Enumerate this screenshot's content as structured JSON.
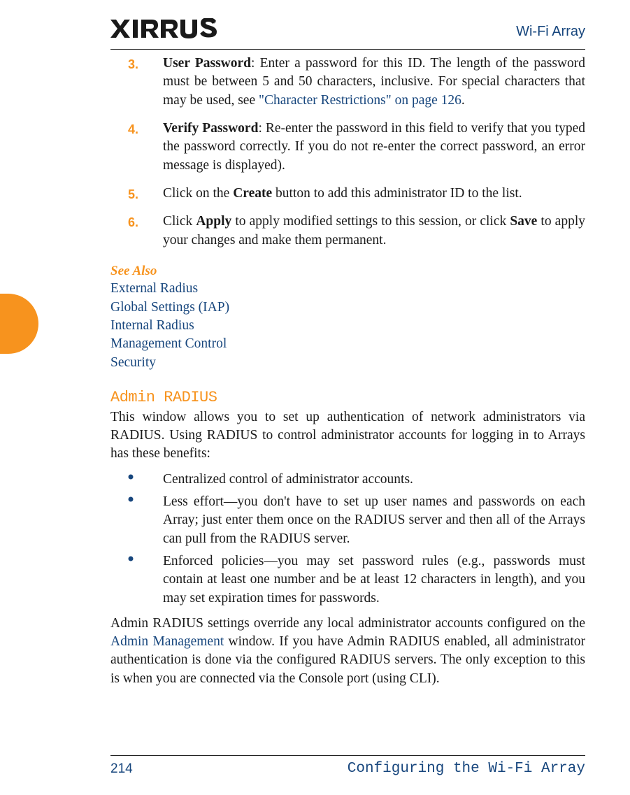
{
  "header": {
    "brand": "XIRRUS",
    "doc_title": "Wi-Fi Array"
  },
  "items": {
    "n3": "3.",
    "t3_label": "User Password",
    "t3_rest": ": Enter a password for this ID. The length of the password must be between 5 and 50 characters, inclusive. For special characters that may be used, see ",
    "t3_link": "\"Character Restrictions\" on page 126",
    "t3_end": ".",
    "n4": "4.",
    "t4_label": "Verify Password",
    "t4_rest": ": Re-enter the password in this field to verify that you typed the password correctly. If you do not re-enter the correct password, an error message is displayed).",
    "n5": "5.",
    "t5_a": "Click on the ",
    "t5_b": "Create",
    "t5_c": " button to add this administrator ID to the list.",
    "n6": "6.",
    "t6_a": "Click ",
    "t6_b": "Apply",
    "t6_c": " to apply modified settings to this session, or click ",
    "t6_d": "Save",
    "t6_e": " to apply your changes and make them permanent."
  },
  "see_also": {
    "heading": "See Also",
    "links": {
      "a": "External Radius",
      "b": "Global Settings (IAP)",
      "c": "Internal Radius",
      "d": "Management Control",
      "e": "Security"
    }
  },
  "section": {
    "heading": "Admin RADIUS",
    "intro": "This window allows you to set up authentication of network administrators via RADIUS. Using RADIUS to control administrator accounts for logging in to Arrays has these benefits:",
    "b1": "Centralized control of administrator accounts.",
    "b2": "Less effort—you don't have to set up user names and passwords on each Array; just enter them once on the RADIUS server and then all of the Arrays can pull from the RADIUS server.",
    "b3": "Enforced policies—you may set password rules (e.g., passwords must contain at least one number and be at least 12 characters in length), and you may set expiration times for passwords.",
    "p2_a": "Admin RADIUS settings override any local administrator accounts configured on the ",
    "p2_link": "Admin Management",
    "p2_b": " window. If you have Admin RADIUS enabled, all administrator authentication is done via the configured RADIUS servers. The only exception to this is when you are connected via the Console port (using CLI)."
  },
  "footer": {
    "page": "214",
    "chapter": "Configuring the Wi-Fi Array"
  }
}
